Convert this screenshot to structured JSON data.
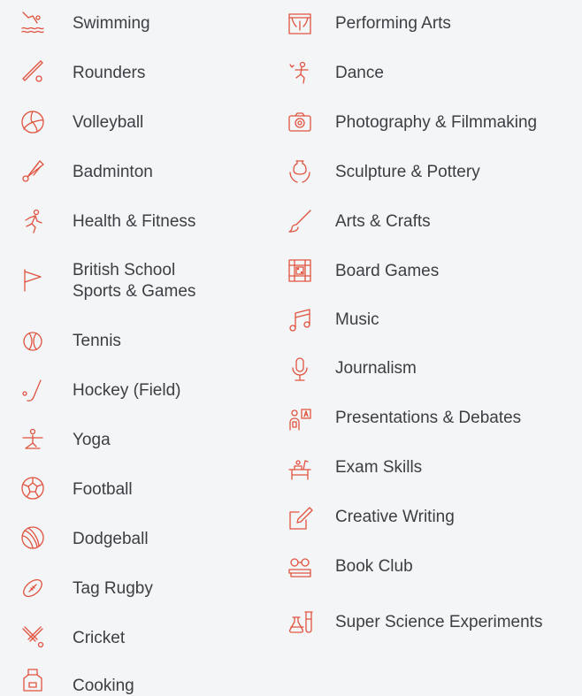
{
  "accent_color": "#e0533f",
  "left_items": [
    {
      "label": "Swimming",
      "icon": "swimmer-icon"
    },
    {
      "label": "Rounders",
      "icon": "bat-and-ball-icon"
    },
    {
      "label": "Volleyball",
      "icon": "volleyball-icon"
    },
    {
      "label": "Badminton",
      "icon": "shuttlecock-icon"
    },
    {
      "label": "Health & Fitness",
      "icon": "runner-icon"
    },
    {
      "label": "British School",
      "label2": "Sports & Games",
      "icon": "flag-icon"
    },
    {
      "label": "Tennis",
      "icon": "tennis-ball-icon"
    },
    {
      "label": "Hockey (Field)",
      "icon": "hockey-stick-icon"
    },
    {
      "label": "Yoga",
      "icon": "yoga-pose-icon"
    },
    {
      "label": "Football",
      "icon": "football-icon"
    },
    {
      "label": "Dodgeball",
      "icon": "dodgeball-icon"
    },
    {
      "label": "Tag Rugby",
      "icon": "rugby-ball-icon"
    },
    {
      "label": "Cricket",
      "icon": "crossed-bats-icon"
    },
    {
      "label": "Cooking",
      "icon": "apron-icon"
    }
  ],
  "right_items": [
    {
      "label": "Performing Arts",
      "icon": "theatre-stage-icon"
    },
    {
      "label": "Dance",
      "icon": "dancer-icon"
    },
    {
      "label": "Photography & Filmmaking",
      "icon": "camera-icon"
    },
    {
      "label": "Sculpture & Pottery",
      "icon": "pottery-hands-icon"
    },
    {
      "label": "Arts & Crafts",
      "icon": "paintbrush-icon"
    },
    {
      "label": "Board Games",
      "icon": "game-board-icon"
    },
    {
      "label": "Music",
      "icon": "music-note-icon"
    },
    {
      "label": "Journalism",
      "icon": "microphone-icon"
    },
    {
      "label": "Presentations & Debates",
      "icon": "presenter-board-icon"
    },
    {
      "label": "Exam Skills",
      "icon": "desk-study-icon"
    },
    {
      "label": "Creative Writing",
      "icon": "pencil-paper-icon"
    },
    {
      "label": "Book Club",
      "icon": "books-glasses-icon"
    },
    {
      "label": "Super Science Experiments",
      "icon": "science-flask-icon"
    }
  ]
}
